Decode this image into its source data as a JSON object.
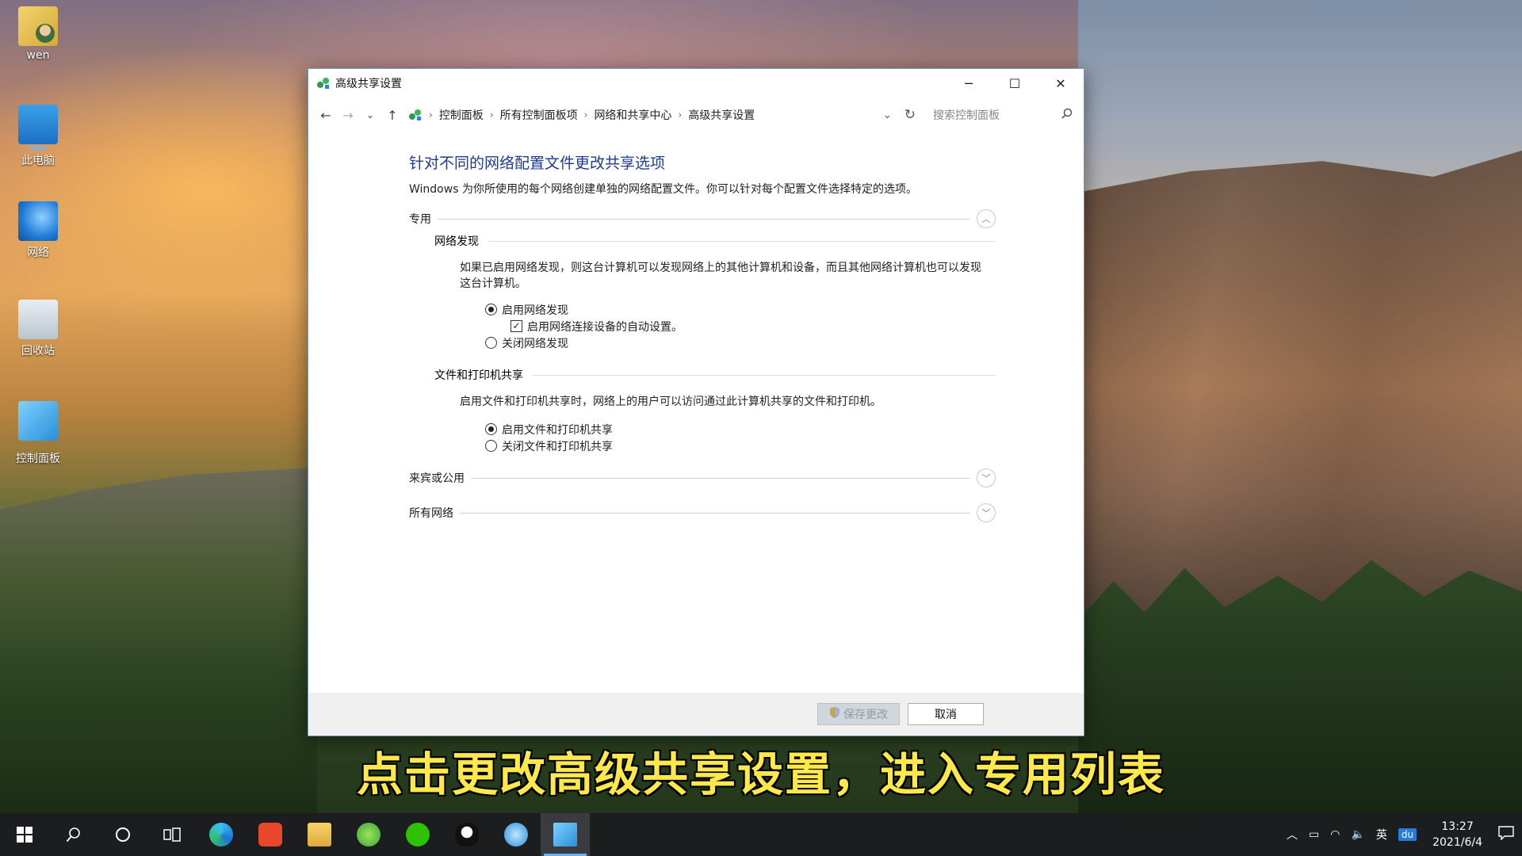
{
  "desktop": {
    "icons": [
      {
        "label": "wen",
        "icon": "user-folder-icon"
      },
      {
        "label": "此电脑",
        "icon": "computer-icon"
      },
      {
        "label": "网络",
        "icon": "network-icon"
      },
      {
        "label": "回收站",
        "icon": "recycle-bin-icon"
      },
      {
        "label": "控制面板",
        "icon": "control-panel-icon"
      }
    ]
  },
  "window": {
    "title": "高级共享设置",
    "controls": {
      "minimize": "─",
      "maximize": "☐",
      "close": "✕"
    },
    "address": {
      "crumbs": [
        "控制面板",
        "所有控制面板项",
        "网络和共享中心",
        "高级共享设置"
      ],
      "search_placeholder": "搜索控制面板"
    },
    "heading": "针对不同的网络配置文件更改共享选项",
    "intro": "Windows 为你所使用的每个网络创建单独的网络配置文件。你可以针对每个配置文件选择特定的选项。",
    "private": {
      "label": "专用",
      "network_discovery": {
        "label": "网络发现",
        "description": "如果已启用网络发现，则这台计算机可以发现网络上的其他计算机和设备，而且其他网络计算机也可以发现这台计算机。",
        "opt_on": "启用网络发现",
        "opt_auto": "启用网络连接设备的自动设置。",
        "opt_off": "关闭网络发现"
      },
      "file_sharing": {
        "label": "文件和打印机共享",
        "description": "启用文件和打印机共享时，网络上的用户可以访问通过此计算机共享的文件和打印机。",
        "opt_on": "启用文件和打印机共享",
        "opt_off": "关闭文件和打印机共享"
      }
    },
    "guest": {
      "label": "来宾或公用"
    },
    "all": {
      "label": "所有网络"
    },
    "footer": {
      "save": "保存更改",
      "cancel": "取消"
    }
  },
  "subtitle": "点击更改高级共享设置，进入专用列表",
  "taskbar": {
    "ime": "英",
    "baidu": "du",
    "time": "13:27",
    "date": "2021/6/4"
  }
}
